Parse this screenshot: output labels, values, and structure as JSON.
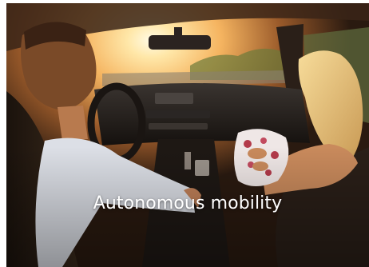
{
  "card": {
    "caption": "Autonomous mobility",
    "image": {
      "subject": "car-interior-sunset-photo",
      "colors": {
        "sun_glow": "#fff3c8",
        "warm_orange": "#f2a24a",
        "interior_dark": "#1e1510",
        "caption_text": "#ffffff"
      }
    }
  }
}
